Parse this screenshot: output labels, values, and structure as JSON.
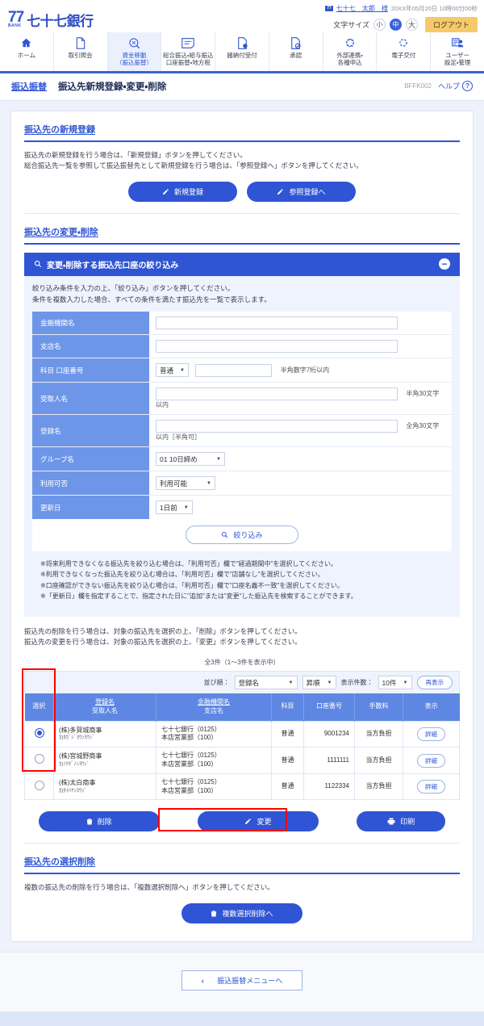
{
  "header": {
    "bank_mark": "77",
    "bank_mark_sub": "BANK",
    "bank_name": "七十七銀行",
    "user_badge": "77",
    "user_name": "七十七　太郎　様",
    "timestamp": "20XX年05月20日 10時00分00秒",
    "text_size_label": "文字サイズ",
    "size_small": "小",
    "size_medium": "中",
    "size_large": "大",
    "logout": "ログアウト",
    "accent_color": "#2f55d4",
    "logout_color": "#f6c96b"
  },
  "gnav": [
    {
      "label": "ホーム",
      "icon": "home-icon",
      "active": false
    },
    {
      "label": "取引照会",
      "icon": "document-icon",
      "active": false
    },
    {
      "label": "資金移動\n（振込振替）",
      "icon": "money-transfer-icon",
      "active": true
    },
    {
      "label": "総合振込・給与振込\n口座振替・地方税",
      "icon": "form-icon",
      "active": false
    },
    {
      "label": "諸納付受付",
      "icon": "payment-icon",
      "active": false
    },
    {
      "label": "承認",
      "icon": "approval-icon",
      "active": false
    },
    {
      "label": "外部連携・\n各種申込",
      "icon": "link-icon",
      "active": false
    },
    {
      "label": "電子交付",
      "icon": "delivery-icon",
      "active": false
    },
    {
      "label": "ユーザー\n設定・管理",
      "icon": "user-settings-icon",
      "active": false
    }
  ],
  "titlebar": {
    "category": "振込振替",
    "title": "振込先新規登録・変更・削除",
    "screen_code": "BFFK002",
    "help": "ヘルプ",
    "help_icon": "question-mark-icon"
  },
  "new_register": {
    "section_title": "振込先の新規登録",
    "desc_line1": "振込先の新規登録を行う場合は、「新規登録」ボタンを押してください。",
    "desc_line2": "総合振込先一覧を参照して振込振替先として新規登録を行う場合は、「参照登録へ」ボタンを押してください。",
    "btn_new": "新規登録",
    "btn_reference": "参照登録へ"
  },
  "modify_delete": {
    "section_title": "振込先の変更・削除",
    "filter_header": "変更・削除する振込先口座の絞り込み",
    "filter_header_icon": "search-icon",
    "collapse_icon": "minus-circle-icon",
    "filter_note1": "絞り込み条件を入力の上、「絞り込み」ボタンを押してください。",
    "filter_note2": "条件を複数入力した場合、すべての条件を満たす振込先を一覧で表示します。",
    "fields": [
      {
        "label": "金融機関名",
        "type": "text",
        "value": "",
        "hint": ""
      },
      {
        "label": "支店名",
        "type": "text",
        "value": "",
        "hint": ""
      },
      {
        "label": "科目 口座番号",
        "type": "select_text",
        "select_value": "普通",
        "value": "",
        "hint": "半角数字7桁以内"
      },
      {
        "label": "受取人名",
        "type": "text",
        "value": "",
        "hint": "半角30文字以内"
      },
      {
        "label": "登録名",
        "type": "text",
        "value": "",
        "hint": "全角30文字以内［半角可］"
      },
      {
        "label": "グループ名",
        "type": "select",
        "select_value": "01 10日締め",
        "hint": ""
      },
      {
        "label": "利用可否",
        "type": "select",
        "select_value": "利用可能",
        "hint": ""
      },
      {
        "label": "更新日",
        "type": "select",
        "select_value": "1日前",
        "hint": ""
      }
    ],
    "filter_button": "絞り込み",
    "notes": [
      "※将来利用できなくなる振込先を絞り込む場合は、「利用可否」欄で\"経過期間中\"を選択してください。",
      "※利用できなくなった振込先を絞り込む場合は、「利用可否」欄で\"店舗なし\"を選択してください。",
      "※口座確認ができない振込先を絞り込む場合は、「利用可否」欄で\"口座名義不一致\"を選択してください。",
      "※「更新日」欄を指定することで、指定された日に\"追加\"または\"変更\"した振込先を検索することができます。"
    ],
    "action_note1": "振込先の削除を行う場合は、対象の振込先を選択の上、「削除」ボタンを押してください。",
    "action_note2": "振込先の変更を行う場合は、対象の振込先を選択の上、「変更」ボタンを押してください。"
  },
  "result": {
    "count_text": "全3件（1～3件を表示中）",
    "sort_label": "並び順：",
    "sort_value": "登録名",
    "order_value": "昇順",
    "per_page_label": "表示件数：",
    "per_page_value": "10件",
    "refresh_button": "再表示",
    "columns": {
      "select": "選択",
      "name1": "登録名",
      "name2": "受取人名",
      "bank1": "金融機関名",
      "bank2": "支店名",
      "subject": "科目",
      "account": "口座番号",
      "fee": "手数料",
      "view": "表示"
    },
    "rows": [
      {
        "selected": true,
        "name": "(株)多賀城商事",
        "kana": "ｶ)ﾀｶﾞｼﾞﾖｳｼﾖｳｼﾞ",
        "bank": "七十七銀行（0125）",
        "branch": "本店営業部（100）",
        "subject": "普通",
        "account": "9001234",
        "fee": "当方負担",
        "detail": "詳細"
      },
      {
        "selected": false,
        "name": "(株)宮城野商事",
        "kana": "ｶ)ﾐﾔｷﾞﾉｼﾖｳｼﾞ",
        "bank": "七十七銀行（0125）",
        "branch": "本店営業部（100）",
        "subject": "普通",
        "account": "1111111",
        "fee": "当方負担",
        "detail": "詳細"
      },
      {
        "selected": false,
        "name": "(株)太白商事",
        "kana": "ｶ)ﾀｲﾊｸｼﾖｳｼﾞ",
        "bank": "七十七銀行（0125）",
        "branch": "本店営業部（100）",
        "subject": "普通",
        "account": "1122334",
        "fee": "当方負担",
        "detail": "詳細"
      }
    ],
    "btn_delete": "削除",
    "btn_modify": "変更",
    "btn_print": "印刷"
  },
  "multi_delete": {
    "section_title": "振込先の選択削除",
    "desc": "複数の振込先の削除を行う場合は、「複数選択削除へ」ボタンを押してください。",
    "button": "複数選択削除へ"
  },
  "footer": {
    "back_button": "振込振替メニューへ",
    "back_icon": "chevron-left-icon"
  }
}
